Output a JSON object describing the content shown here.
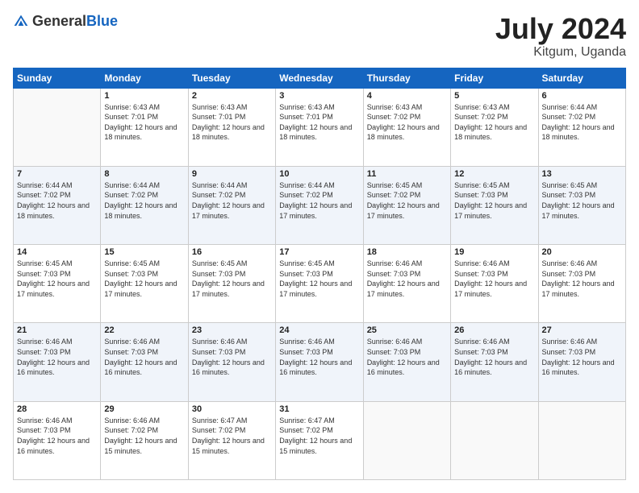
{
  "header": {
    "logo_general": "General",
    "logo_blue": "Blue",
    "title": "July 2024",
    "location": "Kitgum, Uganda"
  },
  "days": [
    "Sunday",
    "Monday",
    "Tuesday",
    "Wednesday",
    "Thursday",
    "Friday",
    "Saturday"
  ],
  "weeks": [
    [
      {
        "date": "",
        "sunrise": "",
        "sunset": "",
        "daylight": ""
      },
      {
        "date": "1",
        "sunrise": "Sunrise: 6:43 AM",
        "sunset": "Sunset: 7:01 PM",
        "daylight": "Daylight: 12 hours and 18 minutes."
      },
      {
        "date": "2",
        "sunrise": "Sunrise: 6:43 AM",
        "sunset": "Sunset: 7:01 PM",
        "daylight": "Daylight: 12 hours and 18 minutes."
      },
      {
        "date": "3",
        "sunrise": "Sunrise: 6:43 AM",
        "sunset": "Sunset: 7:01 PM",
        "daylight": "Daylight: 12 hours and 18 minutes."
      },
      {
        "date": "4",
        "sunrise": "Sunrise: 6:43 AM",
        "sunset": "Sunset: 7:02 PM",
        "daylight": "Daylight: 12 hours and 18 minutes."
      },
      {
        "date": "5",
        "sunrise": "Sunrise: 6:43 AM",
        "sunset": "Sunset: 7:02 PM",
        "daylight": "Daylight: 12 hours and 18 minutes."
      },
      {
        "date": "6",
        "sunrise": "Sunrise: 6:44 AM",
        "sunset": "Sunset: 7:02 PM",
        "daylight": "Daylight: 12 hours and 18 minutes."
      }
    ],
    [
      {
        "date": "7",
        "sunrise": "Sunrise: 6:44 AM",
        "sunset": "Sunset: 7:02 PM",
        "daylight": "Daylight: 12 hours and 18 minutes."
      },
      {
        "date": "8",
        "sunrise": "Sunrise: 6:44 AM",
        "sunset": "Sunset: 7:02 PM",
        "daylight": "Daylight: 12 hours and 18 minutes."
      },
      {
        "date": "9",
        "sunrise": "Sunrise: 6:44 AM",
        "sunset": "Sunset: 7:02 PM",
        "daylight": "Daylight: 12 hours and 17 minutes."
      },
      {
        "date": "10",
        "sunrise": "Sunrise: 6:44 AM",
        "sunset": "Sunset: 7:02 PM",
        "daylight": "Daylight: 12 hours and 17 minutes."
      },
      {
        "date": "11",
        "sunrise": "Sunrise: 6:45 AM",
        "sunset": "Sunset: 7:02 PM",
        "daylight": "Daylight: 12 hours and 17 minutes."
      },
      {
        "date": "12",
        "sunrise": "Sunrise: 6:45 AM",
        "sunset": "Sunset: 7:03 PM",
        "daylight": "Daylight: 12 hours and 17 minutes."
      },
      {
        "date": "13",
        "sunrise": "Sunrise: 6:45 AM",
        "sunset": "Sunset: 7:03 PM",
        "daylight": "Daylight: 12 hours and 17 minutes."
      }
    ],
    [
      {
        "date": "14",
        "sunrise": "Sunrise: 6:45 AM",
        "sunset": "Sunset: 7:03 PM",
        "daylight": "Daylight: 12 hours and 17 minutes."
      },
      {
        "date": "15",
        "sunrise": "Sunrise: 6:45 AM",
        "sunset": "Sunset: 7:03 PM",
        "daylight": "Daylight: 12 hours and 17 minutes."
      },
      {
        "date": "16",
        "sunrise": "Sunrise: 6:45 AM",
        "sunset": "Sunset: 7:03 PM",
        "daylight": "Daylight: 12 hours and 17 minutes."
      },
      {
        "date": "17",
        "sunrise": "Sunrise: 6:45 AM",
        "sunset": "Sunset: 7:03 PM",
        "daylight": "Daylight: 12 hours and 17 minutes."
      },
      {
        "date": "18",
        "sunrise": "Sunrise: 6:46 AM",
        "sunset": "Sunset: 7:03 PM",
        "daylight": "Daylight: 12 hours and 17 minutes."
      },
      {
        "date": "19",
        "sunrise": "Sunrise: 6:46 AM",
        "sunset": "Sunset: 7:03 PM",
        "daylight": "Daylight: 12 hours and 17 minutes."
      },
      {
        "date": "20",
        "sunrise": "Sunrise: 6:46 AM",
        "sunset": "Sunset: 7:03 PM",
        "daylight": "Daylight: 12 hours and 17 minutes."
      }
    ],
    [
      {
        "date": "21",
        "sunrise": "Sunrise: 6:46 AM",
        "sunset": "Sunset: 7:03 PM",
        "daylight": "Daylight: 12 hours and 16 minutes."
      },
      {
        "date": "22",
        "sunrise": "Sunrise: 6:46 AM",
        "sunset": "Sunset: 7:03 PM",
        "daylight": "Daylight: 12 hours and 16 minutes."
      },
      {
        "date": "23",
        "sunrise": "Sunrise: 6:46 AM",
        "sunset": "Sunset: 7:03 PM",
        "daylight": "Daylight: 12 hours and 16 minutes."
      },
      {
        "date": "24",
        "sunrise": "Sunrise: 6:46 AM",
        "sunset": "Sunset: 7:03 PM",
        "daylight": "Daylight: 12 hours and 16 minutes."
      },
      {
        "date": "25",
        "sunrise": "Sunrise: 6:46 AM",
        "sunset": "Sunset: 7:03 PM",
        "daylight": "Daylight: 12 hours and 16 minutes."
      },
      {
        "date": "26",
        "sunrise": "Sunrise: 6:46 AM",
        "sunset": "Sunset: 7:03 PM",
        "daylight": "Daylight: 12 hours and 16 minutes."
      },
      {
        "date": "27",
        "sunrise": "Sunrise: 6:46 AM",
        "sunset": "Sunset: 7:03 PM",
        "daylight": "Daylight: 12 hours and 16 minutes."
      }
    ],
    [
      {
        "date": "28",
        "sunrise": "Sunrise: 6:46 AM",
        "sunset": "Sunset: 7:03 PM",
        "daylight": "Daylight: 12 hours and 16 minutes."
      },
      {
        "date": "29",
        "sunrise": "Sunrise: 6:46 AM",
        "sunset": "Sunset: 7:02 PM",
        "daylight": "Daylight: 12 hours and 15 minutes."
      },
      {
        "date": "30",
        "sunrise": "Sunrise: 6:47 AM",
        "sunset": "Sunset: 7:02 PM",
        "daylight": "Daylight: 12 hours and 15 minutes."
      },
      {
        "date": "31",
        "sunrise": "Sunrise: 6:47 AM",
        "sunset": "Sunset: 7:02 PM",
        "daylight": "Daylight: 12 hours and 15 minutes."
      },
      {
        "date": "",
        "sunrise": "",
        "sunset": "",
        "daylight": ""
      },
      {
        "date": "",
        "sunrise": "",
        "sunset": "",
        "daylight": ""
      },
      {
        "date": "",
        "sunrise": "",
        "sunset": "",
        "daylight": ""
      }
    ]
  ]
}
